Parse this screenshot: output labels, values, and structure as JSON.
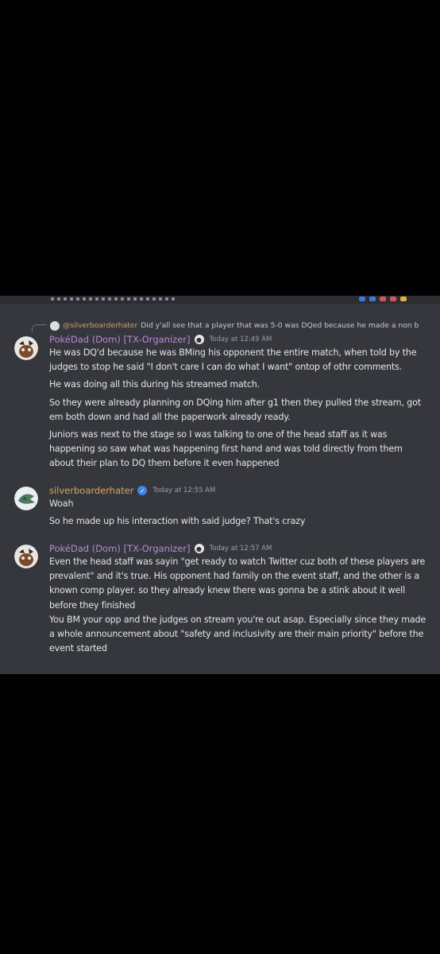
{
  "reply_preview": {
    "mention": "@silverboarderhater",
    "text": "Did y'all see that a player that was 5-0 was DQed because he made a non b"
  },
  "messages": [
    {
      "author": "PokéDad (Dom) [TX-Organizer]",
      "author_color": "#b48ad8",
      "timestamp": "Today at 12:49 AM",
      "lines": [
        "He was DQ'd because he was BMing his opponent the entire match, when told by the",
        "judges to stop he said \"I don't care I can do what I want\" ontop of othr comments.",
        "He was doing all this during his streamed match.",
        "So they were already planning on DQing him after g1 then they pulled the stream, got",
        "em both down and had all the paperwork already ready.",
        "Juniors was next to the stage so I was talking to one of the head staff as it was",
        "happening so saw what was happening first hand and was told directly from them",
        "about their plan to DQ them before it even happened"
      ]
    },
    {
      "author": "silverboarderhater",
      "author_color": "#d9a45a",
      "timestamp": "Today at 12:55 AM",
      "lines": [
        "Woah",
        "So he made up his interaction with said judge? That's crazy"
      ]
    },
    {
      "author": "PokéDad (Dom) [TX-Organizer]",
      "author_color": "#b48ad8",
      "timestamp": "Today at 12:57 AM",
      "lines": [
        "Even the head staff was sayin \"get ready to watch Twitter cuz both of these players are",
        "prevalent\" and it's true. His opponent had family on the event staff, and the other is a",
        "known comp player. so they already knew there was gonna be a stink about it well",
        "before they finished",
        "You BM your opp and the judges on stream you're out asap. Especially since they made",
        "a whole announcement about \"safety and inclusivity are their main priority\" before the",
        "event started"
      ]
    }
  ]
}
